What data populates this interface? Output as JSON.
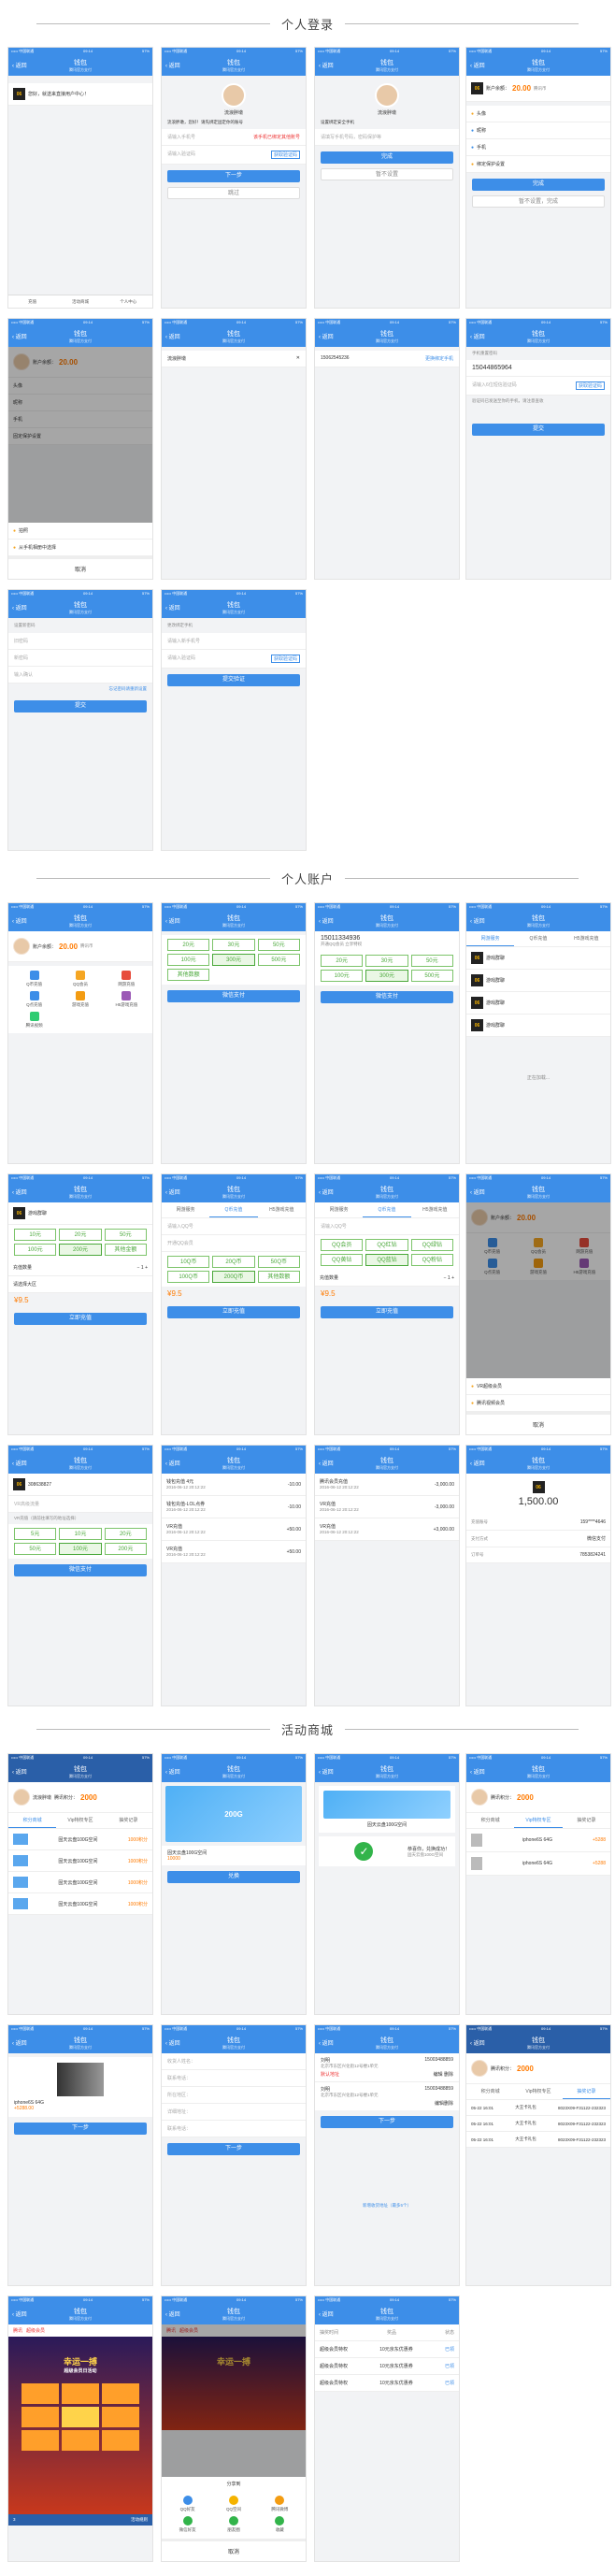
{
  "sections": {
    "login": "个人登录",
    "account": "个人账户",
    "mall": "活动商城"
  },
  "status": {
    "carrier": "••••• 中国联通",
    "time": "09:14",
    "battery": "57%"
  },
  "nav": {
    "back": "返回",
    "title": "钱包",
    "subtitle": "腾讯官方支付"
  },
  "login": {
    "welcome": "您好，就送来直接用户中心！",
    "bottom_tabs": [
      "充值",
      "活动商城",
      "个人中心"
    ],
    "user_name": "流浪胖墩",
    "p2_prompt": "流浪胖墩，您好！请先绑定固定你的账号",
    "phone_placeholder": "请输入手机号",
    "code_btn": "获取验证码",
    "code_placeholder": "请输入验证码",
    "warn": "该手机已绑定其他账号",
    "next": "下一步",
    "skip": "跳过",
    "p3_prompt": "设置绑定安全手机",
    "p3_placeholder": "请填写手机号码，密码保护等",
    "done": "完成",
    "not_now": "暂不设置",
    "balance_label": "账户余额：",
    "balance": "20.00",
    "unit": "腾讯币",
    "menu": [
      "头像",
      "昵称",
      "手机",
      "绑定保护设置"
    ],
    "not_set": "暂不设置，完成",
    "p5_menu": [
      "头像",
      "昵称",
      "手机",
      "固定保护设置"
    ],
    "p5_opts": [
      "拍照",
      "从手机相册中选择"
    ],
    "cancel": "取消",
    "p6_name": "流浪胖墩",
    "p7_phone": "15062545236",
    "p7_change": "更换绑定手机",
    "p8_title": "手机重置密码",
    "p8_phone": "15044865964",
    "p8_code": "请输入6位短信验证码",
    "p8_resend": "获取验证码",
    "p8_tip": "验证码已发送至你的手机，请注意查收",
    "submit": "提交",
    "p9_title": "设置新密码",
    "p9_fields": [
      "旧密码",
      "新密码",
      "输入确认"
    ],
    "p9_forgot": "忘记密码请重新设置",
    "p10_title": "更改绑定手机",
    "p10_fields": [
      "请输入新手机号",
      "请输入验证码"
    ],
    "p10_confirm": "提交验证"
  },
  "account": {
    "balance_label": "账户余额：",
    "balance": "20.00",
    "unit": "腾讯币",
    "icons": [
      "Q币充值",
      "QQ会员",
      "网游充值",
      "Q点充值",
      "游戏充值",
      "H5游戏充值",
      "腾讯视频"
    ],
    "amounts": [
      "20元",
      "30元",
      "50元",
      "100元",
      "300元",
      "500元"
    ],
    "other": "其他数额",
    "pay": "微信支付",
    "qq": "15011334936",
    "qq_sub": "开通QQ会员 立享特权",
    "pay2": "微信支付",
    "games": [
      "游戏群聊",
      "游戏群聊",
      "游戏群聊",
      "游戏群聊"
    ],
    "loading": "正在加载...",
    "g_title": "游戏群聊",
    "g_amounts": [
      "10元",
      "20元",
      "50元",
      "100元",
      "200元",
      "其他金额"
    ],
    "qty_label": "充值数量",
    "area": "请选择大区",
    "price": "¥9.5",
    "recharge": "立即充值",
    "tabs": [
      "网游服务",
      "Q币充值",
      "H5游戏充值"
    ],
    "tab_inputs": [
      "请输入QQ号",
      "开通QQ会员"
    ],
    "qb": [
      "10Q币",
      "20Q币",
      "50Q币",
      "100Q币",
      "200Q币",
      "其他数额"
    ],
    "qq_amounts": [
      "QQ会员",
      "QQ红钻",
      "QQ绿钻",
      "QQ黄钻",
      "QQ蓝钻",
      "QQ粉钻"
    ],
    "list": [
      "VR超级会员",
      "腾讯视频会员"
    ],
    "qq_no": "308638827",
    "vr": "VR高级流量",
    "vr_sub": "VR充值（请前往填写的地址选择）",
    "amounts_vr": [
      "5元",
      "10元",
      "20元",
      "50元",
      "100元",
      "200元"
    ],
    "txn": [
      {
        "t": "钱包充值 4元",
        "d": "2016-06-12 20:12:22",
        "v": "-10.00"
      },
      {
        "t": "钱包充值-LOL点券",
        "d": "2016-06-12 20:12:22",
        "v": "-10.00"
      },
      {
        "t": "VR充值",
        "d": "2016-06-12 20:12:22",
        "v": "+50.00"
      },
      {
        "t": "VR充值",
        "d": "2016-06-12 20:12:22",
        "v": "+50.00"
      }
    ],
    "txn2": [
      {
        "t": "腾讯会员充值",
        "d": "2016-06-12 20:12:22",
        "v": "-3,000.00"
      },
      {
        "t": "VR充值",
        "d": "2016-06-12 20:12:22",
        "v": "-3,000.00"
      },
      {
        "t": "VR充值",
        "d": "2016-06-12 20:12:22",
        "v": "+3,000.00"
      }
    ],
    "detail_amount": "1,500.00",
    "detail_rows": [
      [
        "充值账号",
        "159****4646"
      ],
      [
        "支付方式",
        "微信支付"
      ],
      [
        "订单号",
        "7853824241"
      ]
    ]
  },
  "mall": {
    "score_label": "腾讯积分：",
    "score": "2000",
    "tabs": [
      "积分商城",
      "Vip特权专区",
      "抽奖记录"
    ],
    "items": [
      {
        "name": "固天云盘100G空间",
        "price": "1000积分"
      },
      {
        "name": "固天云盘100G空间",
        "price": "1000积分"
      },
      {
        "name": "固天云盘100G空间",
        "price": "1000积分"
      },
      {
        "name": "固天云盘100G空间",
        "price": "1000积分"
      }
    ],
    "prize": "200G",
    "prize_name": "固天云盘100G空间",
    "prize_price": "10000",
    "exchange": "兑换",
    "success": "恭喜你，兑换成功！",
    "success_sub": "固天云盘100G空间",
    "phones": [
      {
        "name": "iphone6S 64G",
        "price": "+5288"
      },
      {
        "name": "iphone6S 64G",
        "price": "+5288"
      }
    ],
    "phone_item": "iphone6S 64G",
    "phone_price": "+5288.00",
    "next": "下一步",
    "form": [
      "收货人姓名：",
      "联系电话：",
      "所在地区：",
      "详细地址：",
      "联系电话："
    ],
    "addr_name": "刘明",
    "addr_phone": "15003488859",
    "addr_text": "北京市东区兴化街12号楼1单元",
    "default": "默认地址",
    "edit": "编辑",
    "del": "删除",
    "new_addr": "新增收货地址（最多5个）",
    "records_head": [
      "积分商城",
      "Vip特权专区",
      "抽奖记录"
    ],
    "records": [
      [
        "05-22 16:01",
        "大王卡礼包",
        "8023X09-F31122-232323"
      ],
      [
        "05-22 16:01",
        "大王卡礼包",
        "8023X09-F31122-232323"
      ],
      [
        "05-22 16:01",
        "大王卡礼包",
        "8023X09-F31122-232323"
      ]
    ],
    "game_title": "幸运一搏",
    "game_sub": "超级会员日活动",
    "game_tag1": "腾讯",
    "game_tag2": "超级会员",
    "game_count": "3",
    "game_rule": "活动规则",
    "share_title": "分享到",
    "share": [
      "QQ好友",
      "QQ空间",
      "腾讯微博",
      "微信好友",
      "朋友圈",
      "收藏"
    ],
    "rec_head": [
      "抽奖时间",
      "奖品",
      "状态"
    ],
    "rec_rows": [
      [
        "超级会员特权",
        "10元京东优惠券",
        "已领"
      ],
      [
        "超级会员特权",
        "10元京东优惠券",
        "已领"
      ],
      [
        "超级会员特权",
        "10元京东优惠券",
        "已领"
      ]
    ]
  }
}
